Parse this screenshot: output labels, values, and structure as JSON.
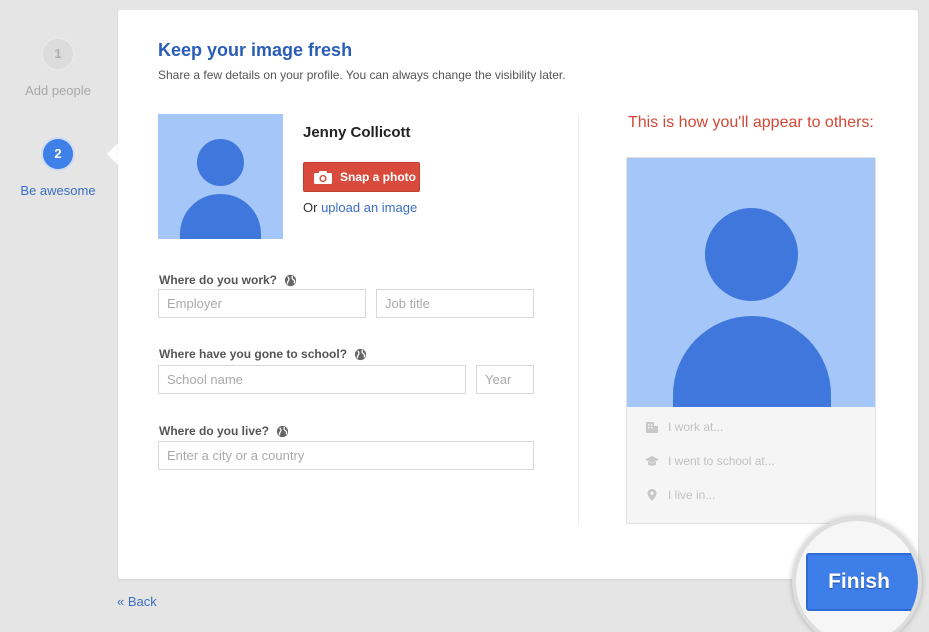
{
  "steps": [
    {
      "number": "1",
      "label": "Add people",
      "state": "inactive"
    },
    {
      "number": "2",
      "label": "Be awesome",
      "state": "active"
    }
  ],
  "header": {
    "title": "Keep your image fresh",
    "subtitle": "Share a few details on your profile. You can always change the visibility later."
  },
  "profile": {
    "name": "Jenny Collicott",
    "snap_label": "Snap a photo",
    "upload_prefix": "Or ",
    "upload_link": "upload an image"
  },
  "questions": {
    "work": {
      "label": "Where do you work?",
      "employer_placeholder": "Employer",
      "job_placeholder": "Job title"
    },
    "school": {
      "label": "Where have you gone to school?",
      "school_placeholder": "School name",
      "year_placeholder": "Year"
    },
    "live": {
      "label": "Where do you live?",
      "city_placeholder": "Enter a city or a country"
    }
  },
  "preview": {
    "title": "This is how you'll appear to others:",
    "rows": [
      "I work at...",
      "I went to school at...",
      "I live in..."
    ]
  },
  "nav": {
    "back_label": "« Back",
    "finish_label": "Finish"
  },
  "colors": {
    "accent_blue": "#3f7fe8",
    "snap_red": "#d84a3b",
    "preview_title_red": "#d14836",
    "avatar_bg": "#a4c6f9",
    "avatar_fg": "#3f77dd"
  }
}
